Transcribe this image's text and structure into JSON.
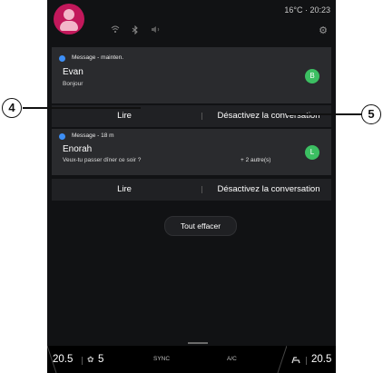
{
  "status": {
    "temp_time": "16°C · 20:23"
  },
  "icons": {
    "profile": "profile-avatar",
    "wifi": "wifi-icon",
    "bluetooth": "bluetooth-icon",
    "volume": "volume-icon",
    "settings": "gear-icon",
    "message": "message-bubble-icon",
    "fan": "fan-icon",
    "seat_heat": "seat-heat-icon"
  },
  "notifications": [
    {
      "meta": "Message - mainten.",
      "sender": "Evan",
      "message": "Bonjour",
      "extra": "",
      "avatar_letter": "B",
      "read_label": "Lire",
      "mute_label": "Désactivez la conversation"
    },
    {
      "meta": "Message - 18 m",
      "sender": "Enorah",
      "message": "Veux-tu passer dîner ce soir ?",
      "extra": "+ 2 autre(s)",
      "avatar_letter": "L",
      "read_label": "Lire",
      "mute_label": "Désactivez la conversation"
    }
  ],
  "clear_all": "Tout effacer",
  "callouts": {
    "read": "4",
    "mute": "5"
  },
  "bottom_bar": {
    "left_temp": "20.5",
    "fan_level": "5",
    "sync": "SYNC",
    "ac": "A/C",
    "right_temp": "20.5"
  },
  "colors": {
    "accent_blue": "#3d8ff6",
    "avatar_green": "#3cbf62",
    "profile_pink": "#c2185b"
  }
}
